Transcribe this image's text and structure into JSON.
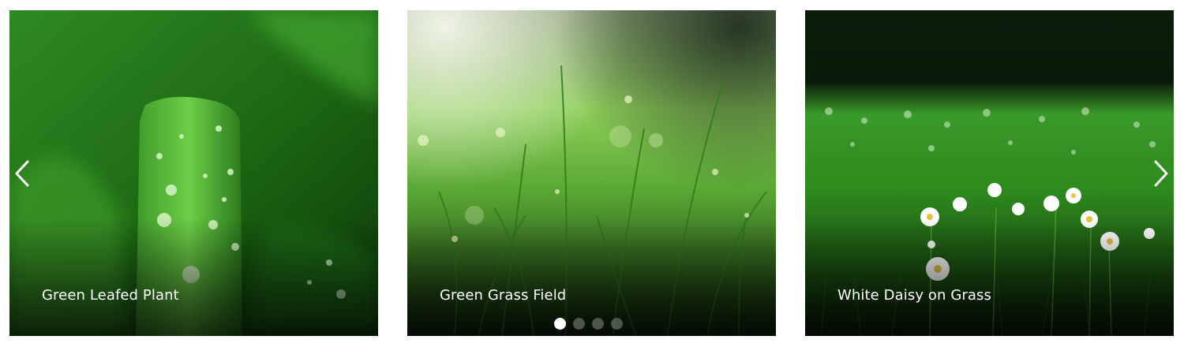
{
  "slides": [
    {
      "caption": "Green Leafed Plant"
    },
    {
      "caption": "Green Grass Field"
    },
    {
      "caption": "White Daisy on Grass"
    }
  ],
  "navigation": {
    "prev_icon": "chevron-left-icon",
    "next_icon": "chevron-right-icon"
  },
  "pagination": {
    "total": 4,
    "active_index": 0
  },
  "colors": {
    "caption_text": "#ffffff",
    "dot_active": "#ffffff"
  }
}
